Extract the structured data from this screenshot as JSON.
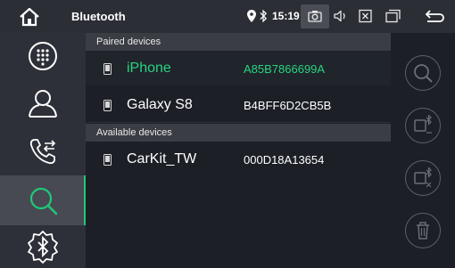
{
  "statusbar": {
    "title": "Bluetooth",
    "time": "15:19",
    "icons": [
      "home-icon",
      "location-icon",
      "bluetooth-icon",
      "camera-icon",
      "volume-icon",
      "close-box-icon",
      "window-icon",
      "back-icon"
    ]
  },
  "sidebar": {
    "items": [
      {
        "icon": "dialpad-icon",
        "active": false
      },
      {
        "icon": "contacts-icon",
        "active": false
      },
      {
        "icon": "call-transfer-icon",
        "active": false
      },
      {
        "icon": "search-icon",
        "active": true
      },
      {
        "icon": "bluetooth-settings-icon",
        "active": false
      }
    ]
  },
  "main": {
    "paired_header": "Paired devices",
    "paired": [
      {
        "name": "iPhone",
        "address": "A85B7866699A",
        "selected": true
      },
      {
        "name": "Galaxy S8",
        "address": "B4BFF6D2CB5B",
        "selected": false
      }
    ],
    "available_header": "Available devices",
    "available": [
      {
        "name": "CarKit_TW",
        "address": "000D18A13654",
        "selected": false
      }
    ]
  },
  "actions": [
    "search-icon",
    "bluetooth-connect-icon",
    "bluetooth-disconnect-icon",
    "delete-icon"
  ],
  "colors": {
    "accent": "#27d480",
    "header": "#3a3d44",
    "sidebar": "#2d3038",
    "background": "#1c1f26"
  }
}
